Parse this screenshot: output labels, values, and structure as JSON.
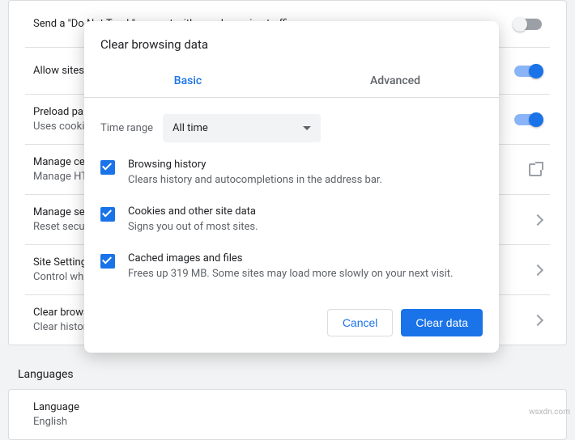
{
  "background": {
    "rows": [
      {
        "title": "Send a \"Do Not Track\" request with your browsing traffic",
        "sub": null,
        "tail": "toggle-off"
      },
      {
        "title": "Allow sites",
        "sub": null,
        "tail": "toggle-on"
      },
      {
        "title": "Preload pa",
        "sub": "Uses cooki",
        "tail": "toggle-on"
      },
      {
        "title": "Manage ce",
        "sub": "Manage HT",
        "tail": "open"
      },
      {
        "title": "Manage se",
        "sub": "Reset secu",
        "tail": "chevron"
      },
      {
        "title": "Site Setting",
        "sub": "Control wha",
        "tail": "chevron"
      },
      {
        "title": "Clear brows",
        "sub": "Clear histor",
        "tail": "chevron"
      }
    ],
    "section_header": "Languages",
    "rows2": [
      {
        "title": "Language",
        "sub": "English",
        "tail": "none"
      }
    ]
  },
  "modal": {
    "title": "Clear browsing data",
    "tabs": {
      "basic": "Basic",
      "advanced": "Advanced"
    },
    "time_range_label": "Time range",
    "time_range_value": "All time",
    "items": [
      {
        "title": "Browsing history",
        "sub": "Clears history and autocompletions in the address bar."
      },
      {
        "title": "Cookies and other site data",
        "sub": "Signs you out of most sites."
      },
      {
        "title": "Cached images and files",
        "sub": "Frees up 319 MB. Some sites may load more slowly on your next visit."
      }
    ],
    "cancel": "Cancel",
    "clear": "Clear data"
  },
  "watermark": "wsxdn.com"
}
